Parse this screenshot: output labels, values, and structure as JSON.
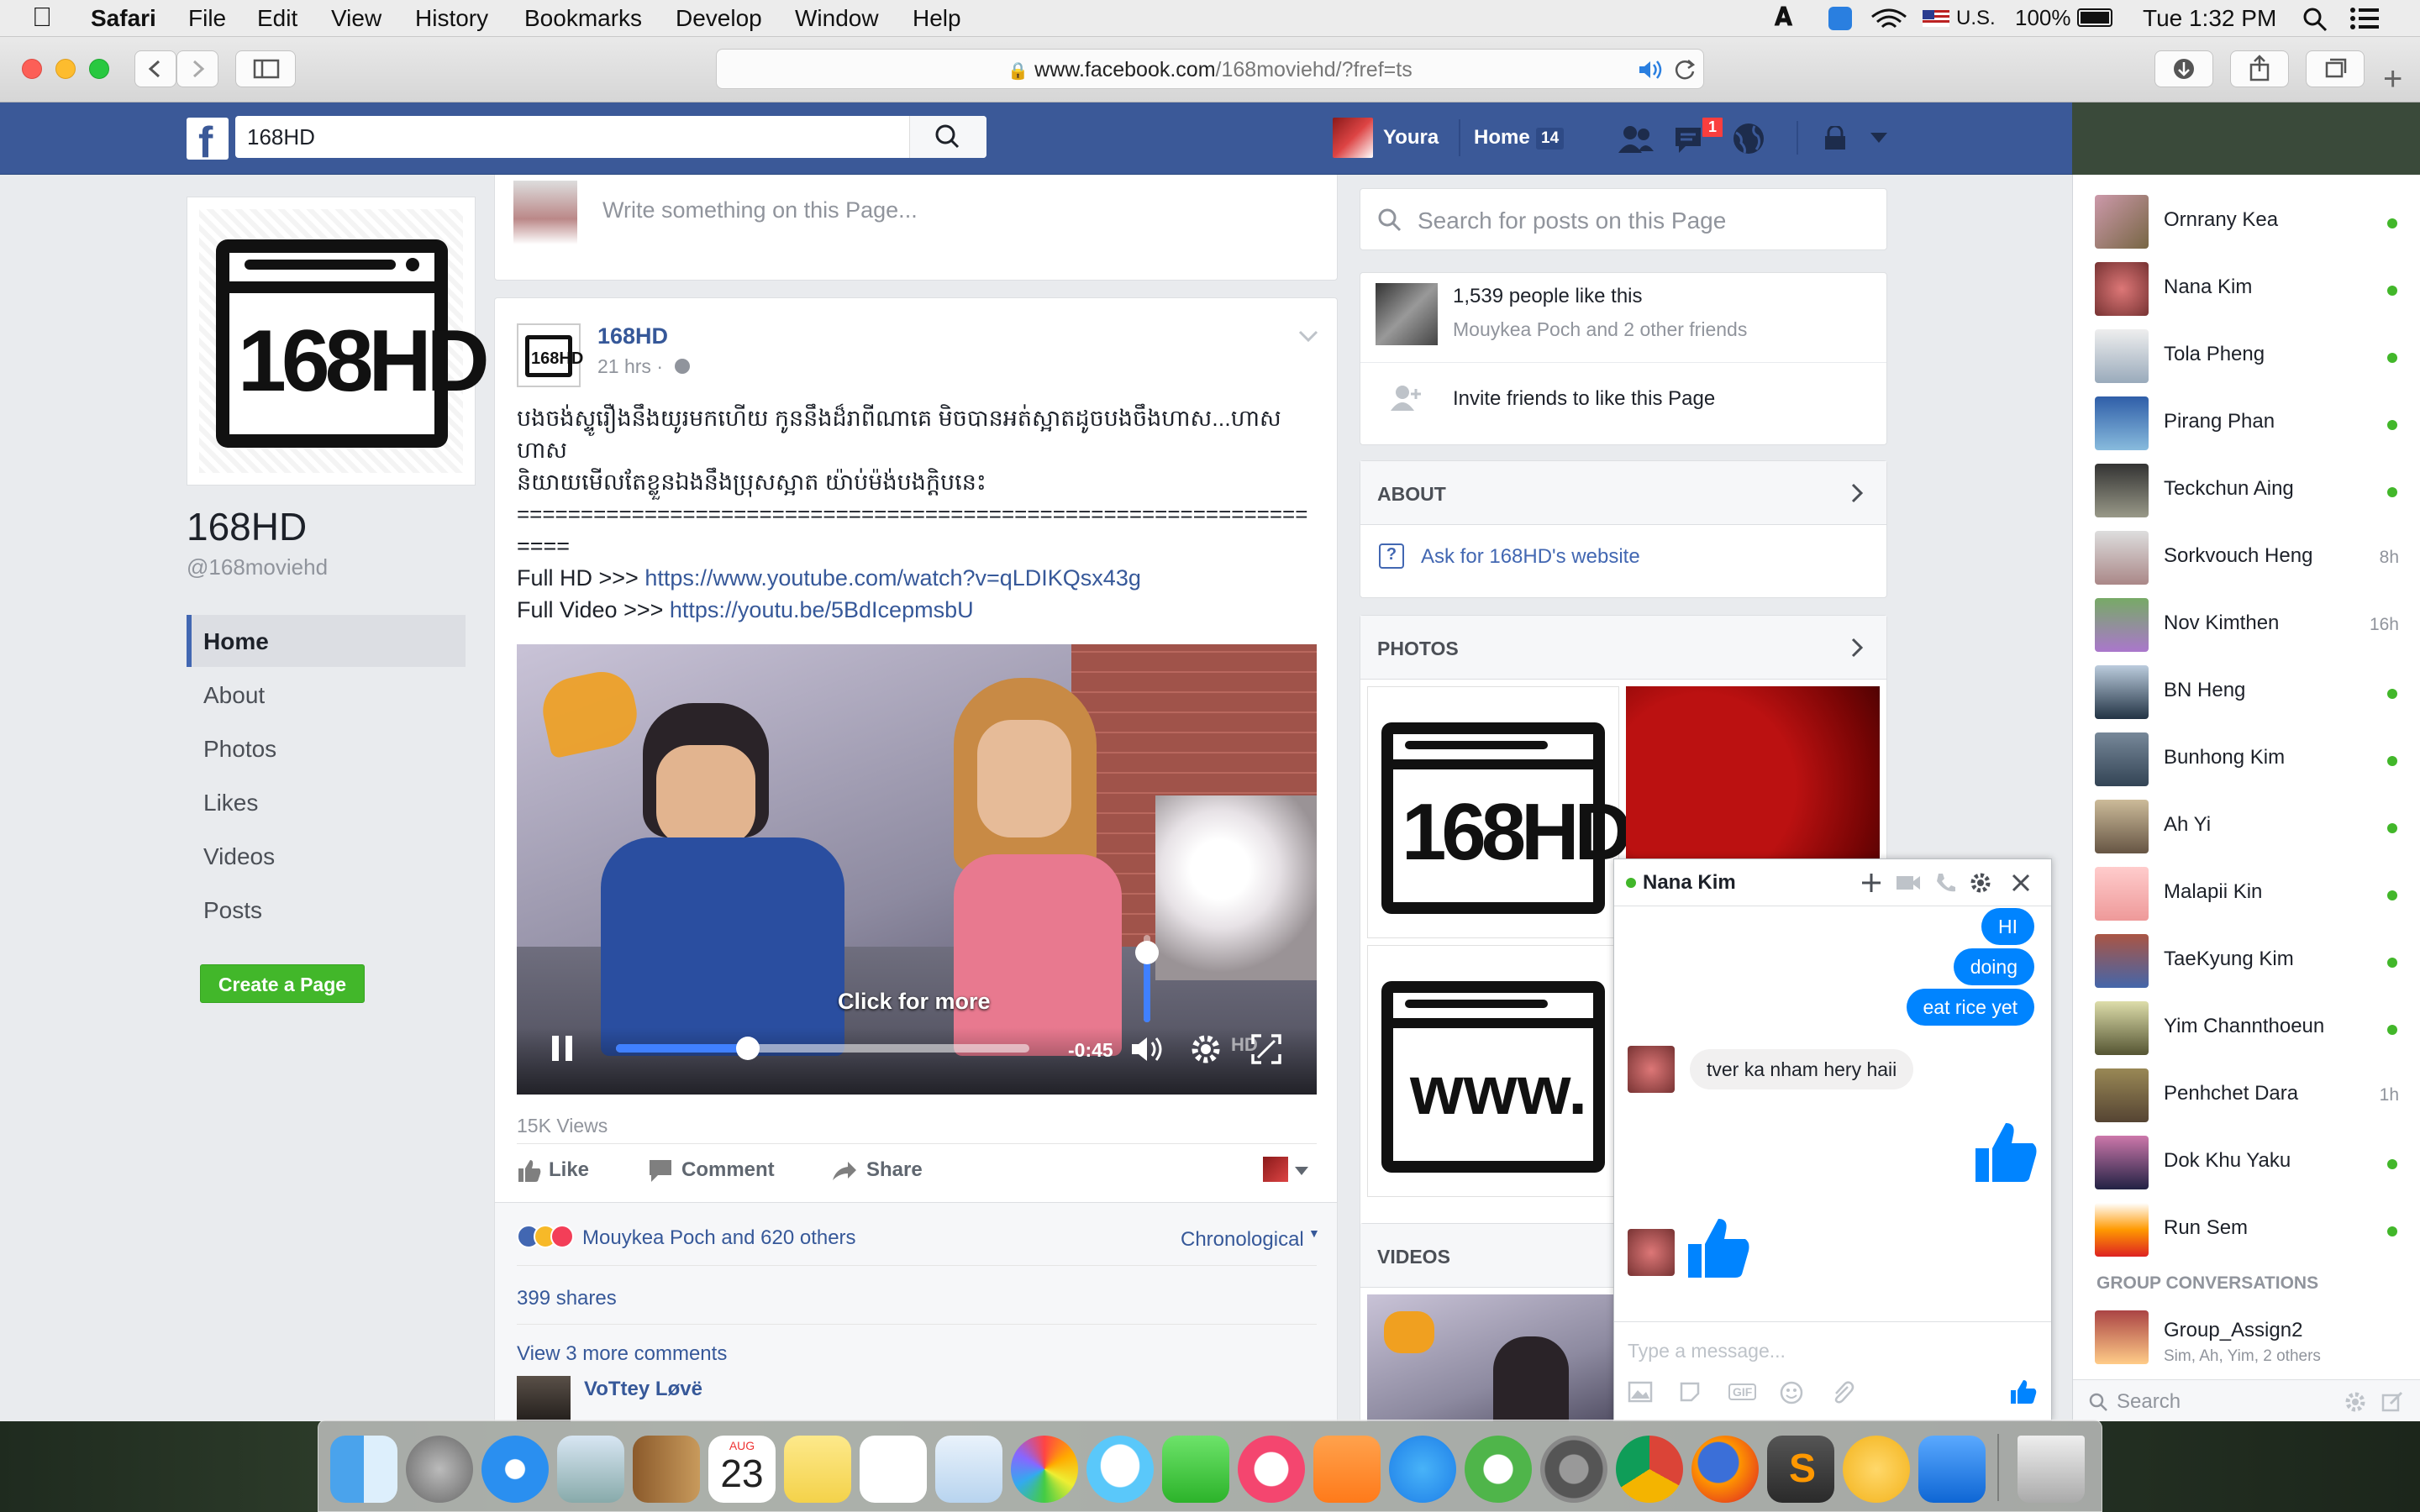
{
  "menubar": {
    "app": "Safari",
    "items": [
      "File",
      "Edit",
      "View",
      "History",
      "Bookmarks",
      "Develop",
      "Window",
      "Help"
    ],
    "input_source": "U.S.",
    "battery": "100%",
    "clock": "Tue 1:32 PM"
  },
  "browser": {
    "url_host": "www.facebook.com",
    "url_path": "/168moviehd/?fref=ts"
  },
  "fb_header": {
    "search_value": "168HD",
    "user_name": "Youra",
    "home_label": "Home",
    "home_count": "14",
    "notification_count": "1"
  },
  "page": {
    "name": "168HD",
    "handle": "@168moviehd",
    "nav": [
      "Home",
      "About",
      "Photos",
      "Likes",
      "Videos",
      "Posts"
    ],
    "active_nav": "Home",
    "create_page_label": "Create a Page",
    "profile_logo_text": "168HD"
  },
  "composer": {
    "placeholder": "Write something on this Page..."
  },
  "post": {
    "author": "168HD",
    "time": "21 hrs ·",
    "text_line1": "បងចង់ស្ទូរឿងនឹងយូរមកហើយ កូននឹងដ៏រាពីណាគេ មិចបានអត់ស្អាតដូចបងចឹងហាស...ហាស",
    "text_line2": "ហាស",
    "text_line3": "និយាយមើលតែខ្លួនឯងនឹងប្រុសស្អាត យ៉ាប់ម៉ង់បងក្ដិបនេះ",
    "separator1": "==============================================================",
    "separator2": "====",
    "full_hd_label": "Full HD >>> ",
    "full_hd_link": "https://www.youtube.com/watch?v=qLDIKQsx43g",
    "full_video_label": "Full Video >>> ",
    "full_video_link": "https://youtu.be/5BdIcepmsbU",
    "video": {
      "overlay_text": "Click for more",
      "time_remaining": "-0:45",
      "progress": 0.32,
      "volume": 0.8,
      "watermark": "HD"
    },
    "views": "15K Views",
    "actions": [
      "Like",
      "Comment",
      "Share"
    ],
    "reactions_text": "Mouykea Poch and 620 others",
    "sort_label": "Chronological",
    "shares": "399 shares",
    "more_comments": "View 3 more comments",
    "commenter": "VoTtey Løvë"
  },
  "right_column": {
    "search_placeholder": "Search for posts on this Page",
    "likes_count": "1,539 people like this",
    "likes_friends": "Mouykea Poch and 2 other friends",
    "invite_text": "Invite friends to like this Page",
    "about_title": "ABOUT",
    "ask_website": "Ask for 168HD's website",
    "photos_title": "PHOTOS",
    "photo1_text": "168HD",
    "photo3_text": "www.",
    "videos_title": "VIDEOS"
  },
  "chat_window": {
    "contact": "Nana Kim",
    "messages_out": [
      "HI",
      "doing",
      "eat rice yet"
    ],
    "message_in": "tver ka nham  hery haii",
    "input_placeholder": "Type a message..."
  },
  "chat_sidebar": {
    "contacts": [
      {
        "name": "Ornrany Kea",
        "status": "online",
        "time": ""
      },
      {
        "name": "Nana Kim",
        "status": "online",
        "time": ""
      },
      {
        "name": "Tola Pheng",
        "status": "online",
        "time": ""
      },
      {
        "name": "Pirang Phan",
        "status": "online",
        "time": ""
      },
      {
        "name": "Teckchun Aing",
        "status": "online",
        "time": ""
      },
      {
        "name": "Sorkvouch Heng",
        "status": "idle",
        "time": "8h"
      },
      {
        "name": "Nov Kimthen",
        "status": "idle",
        "time": "16h"
      },
      {
        "name": "BN Heng",
        "status": "online",
        "time": ""
      },
      {
        "name": "Bunhong Kim",
        "status": "online",
        "time": ""
      },
      {
        "name": "Ah Yi",
        "status": "online",
        "time": ""
      },
      {
        "name": "Malapii Kin",
        "status": "online",
        "time": ""
      },
      {
        "name": "TaeKyung Kim",
        "status": "online",
        "time": ""
      },
      {
        "name": "Yim Channthoeun",
        "status": "online",
        "time": ""
      },
      {
        "name": "Penhchet Dara",
        "status": "idle",
        "time": "1h"
      },
      {
        "name": "Dok Khu Yaku",
        "status": "online",
        "time": ""
      },
      {
        "name": "Run Sem",
        "status": "online",
        "time": ""
      }
    ],
    "group_header": "GROUP CONVERSATIONS",
    "group_name": "Group_Assign2",
    "group_members": "Sim, Ah, Yim, 2 others",
    "search_placeholder": "Search"
  },
  "dock": {
    "calendar_month": "AUG",
    "calendar_day": "23",
    "apps": [
      "finder-icon",
      "launchpad-icon",
      "safari-icon",
      "mail-icon",
      "contacts-icon",
      "calendar-icon",
      "notes-icon",
      "reminders-icon",
      "preview-icon",
      "photos-icon",
      "messages-icon",
      "facetime-icon",
      "itunes-icon",
      "ibooks-icon",
      "app-store-icon",
      "leaf-app-icon",
      "system-preferences-icon",
      "chrome-icon",
      "firefox-icon",
      "sublime-text-icon",
      "game-icon",
      "teamviewer-icon",
      "trash-icon"
    ]
  },
  "colors": {
    "fb_blue": "#3b5998",
    "fb_link": "#365899",
    "online_green": "#42b72a",
    "messenger_blue": "#0084ff",
    "create_page_green": "#42b72a"
  }
}
